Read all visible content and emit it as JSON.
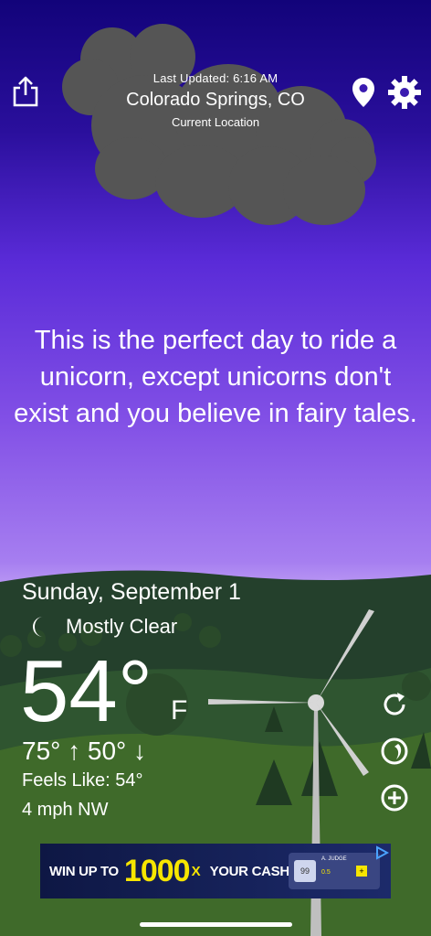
{
  "header": {
    "last_updated": "Last Updated: 6:16 AM",
    "city": "Colorado Springs, CO",
    "location_label": "Current Location"
  },
  "quote": "This is the perfect day to ride a unicorn, except unicorns don't exist and you believe in fairy tales.",
  "weather": {
    "date": "Sunday, September 1",
    "condition": "Mostly Clear",
    "temperature": "54°",
    "unit": "F",
    "high_low": "75° ↑  50° ↓",
    "feels_like": "Feels Like: 54°",
    "wind": "4 mph NW"
  },
  "ad": {
    "left_text": "WIN UP TO",
    "multiplier": "1000",
    "x": "X",
    "right_text": "YOUR CASH",
    "card_name": "A. JUDGE",
    "card_stat": "0.5",
    "card_number": "99"
  },
  "icons": {
    "share": "share-icon",
    "pin": "location-pin-icon",
    "gear": "gear-icon",
    "moon": "moon-icon",
    "refresh": "refresh-icon",
    "radar": "radar-icon",
    "add": "add-icon"
  },
  "colors": {
    "sky_top": "#12037a",
    "sky_bottom": "#c6a9f7",
    "cloud": "#555555",
    "hill_far": "#24402c",
    "hill_near": "#3f6a2a",
    "ad_yellow": "#f7e600"
  }
}
